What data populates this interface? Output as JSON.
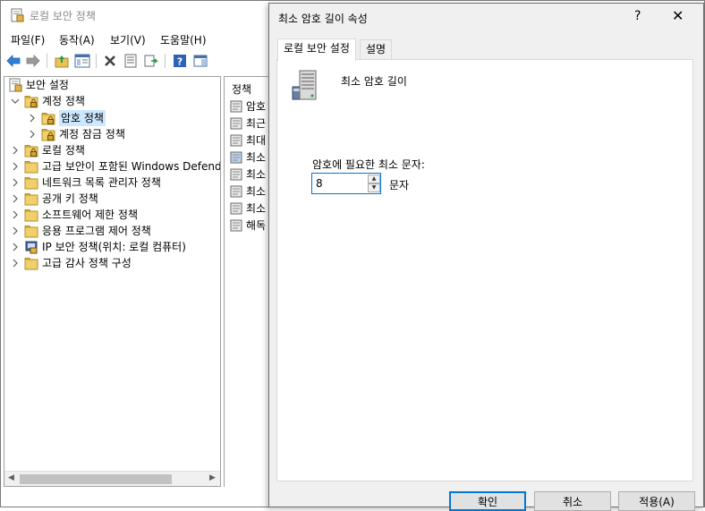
{
  "window": {
    "title": "로컬 보안 정책",
    "menu": [
      "파일(F)",
      "동작(A)",
      "보기(V)",
      "도움말(H)"
    ]
  },
  "tree": {
    "root": "보안 설정",
    "items": [
      {
        "label": "계정 정책",
        "level": 1,
        "expanded": true,
        "icon": "folder-lock"
      },
      {
        "label": "암호 정책",
        "level": 2,
        "selected": true,
        "icon": "folder-lock"
      },
      {
        "label": "계정 잠금 정책",
        "level": 2,
        "icon": "folder-lock"
      },
      {
        "label": "로컬 정책",
        "level": 1,
        "icon": "folder-lock"
      },
      {
        "label": "고급 보안이 포함된 Windows Defender 방화벽",
        "level": 1,
        "icon": "folder"
      },
      {
        "label": "네트워크 목록 관리자 정책",
        "level": 1,
        "icon": "folder"
      },
      {
        "label": "공개 키 정책",
        "level": 1,
        "icon": "folder"
      },
      {
        "label": "소프트웨어 제한 정책",
        "level": 1,
        "icon": "folder"
      },
      {
        "label": "응용 프로그램 제어 정책",
        "level": 1,
        "icon": "folder"
      },
      {
        "label": "IP 보안 정책(위치: 로컬 컴퓨터)",
        "level": 1,
        "icon": "ip-security"
      },
      {
        "label": "고급 감사 정책 구성",
        "level": 1,
        "icon": "folder"
      }
    ]
  },
  "policy_list": {
    "header": "정책",
    "items": [
      "암호",
      "최근",
      "최대",
      "최소",
      "최소",
      "최소",
      "최소",
      "해독"
    ]
  },
  "dialog": {
    "title": "최소 암호 길이 속성",
    "help": "?",
    "close": "✕",
    "tabs": [
      "로컬 보안 설정",
      "설명"
    ],
    "active_tab": 0,
    "heading": "최소 암호 길이",
    "field_label": "암호에 필요한 최소 문자:",
    "value": "8",
    "unit": "문자",
    "buttons": {
      "ok": "확인",
      "cancel": "취소",
      "apply": "적용(A)"
    }
  }
}
